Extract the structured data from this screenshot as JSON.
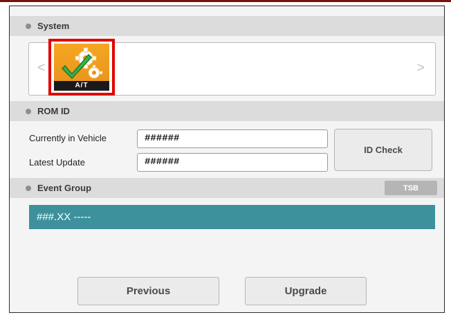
{
  "colors": {
    "accent_red": "#e00000",
    "event_teal": "#3c919c",
    "header_gray": "#dcdcdc",
    "tile_orange": "#f5a623"
  },
  "system": {
    "title": "System",
    "prev_arrow": "<",
    "next_arrow": ">",
    "selected_tile": {
      "label": "A/T",
      "icon": "gear-check-icon"
    }
  },
  "rom_id": {
    "title": "ROM ID",
    "current_label": "Currently in Vehicle",
    "current_value": "######",
    "latest_label": "Latest Update",
    "latest_value": "######",
    "id_check_label": "ID Check"
  },
  "event_group": {
    "title": "Event Group",
    "tsb_label": "TSB",
    "items": [
      {
        "text": "###.XX -----"
      }
    ]
  },
  "buttons": {
    "previous_label": "Previous",
    "upgrade_label": "Upgrade"
  }
}
